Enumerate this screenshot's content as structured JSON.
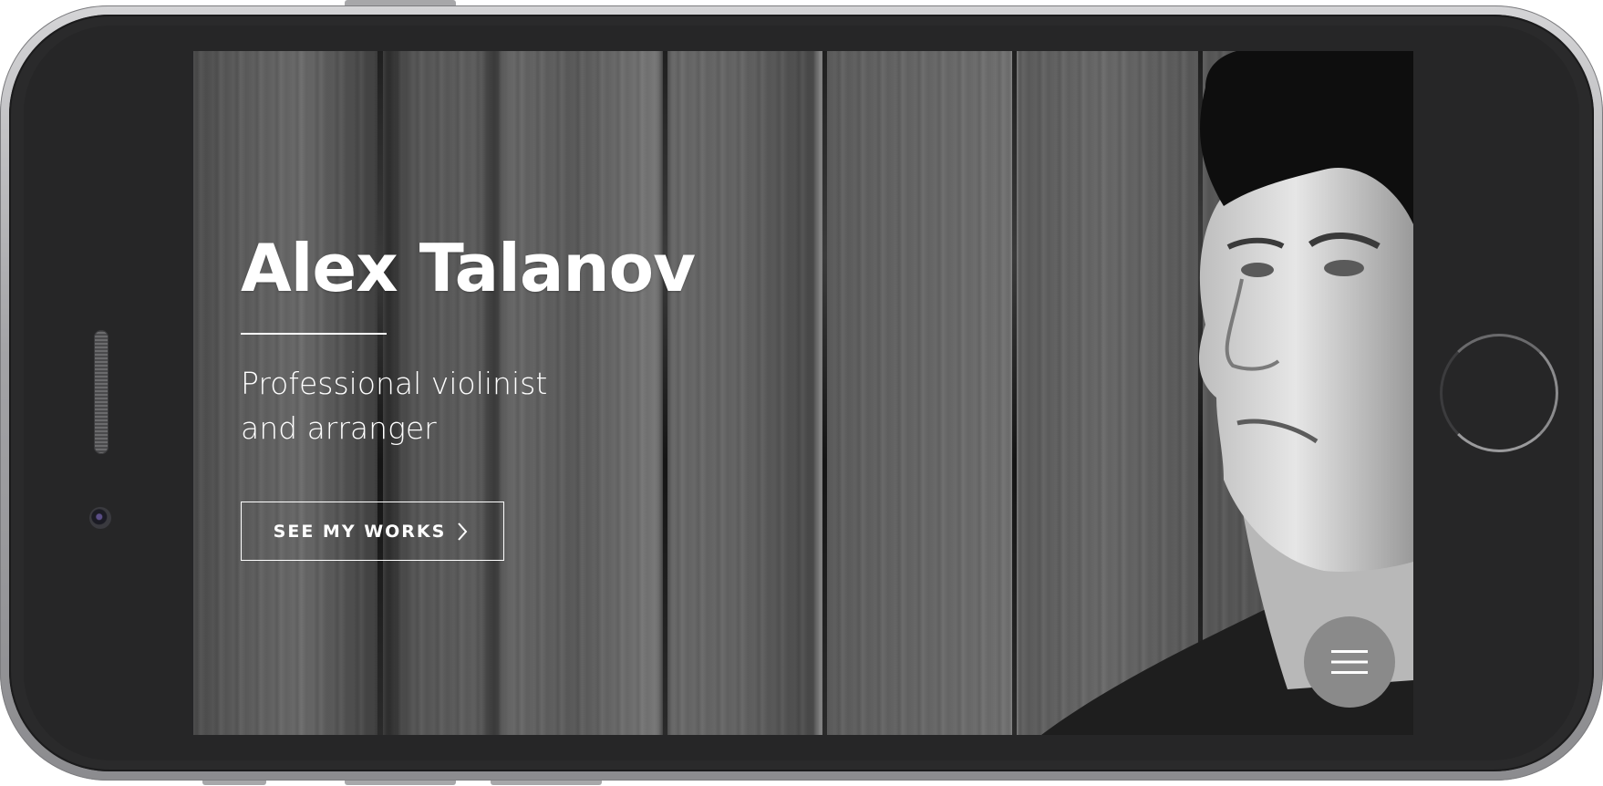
{
  "hero": {
    "title": "Alex Talanov",
    "subtitle_line_1": "Professional violinist",
    "subtitle_line_2": "and arranger",
    "cta_label": "SEE MY WORKS"
  },
  "icons": {
    "cta_chevron": "chevron-right-icon",
    "menu": "hamburger-menu-icon"
  },
  "colors": {
    "text": "#ffffff",
    "menu_button": "#8a8a8a",
    "device_body": "#262627"
  }
}
